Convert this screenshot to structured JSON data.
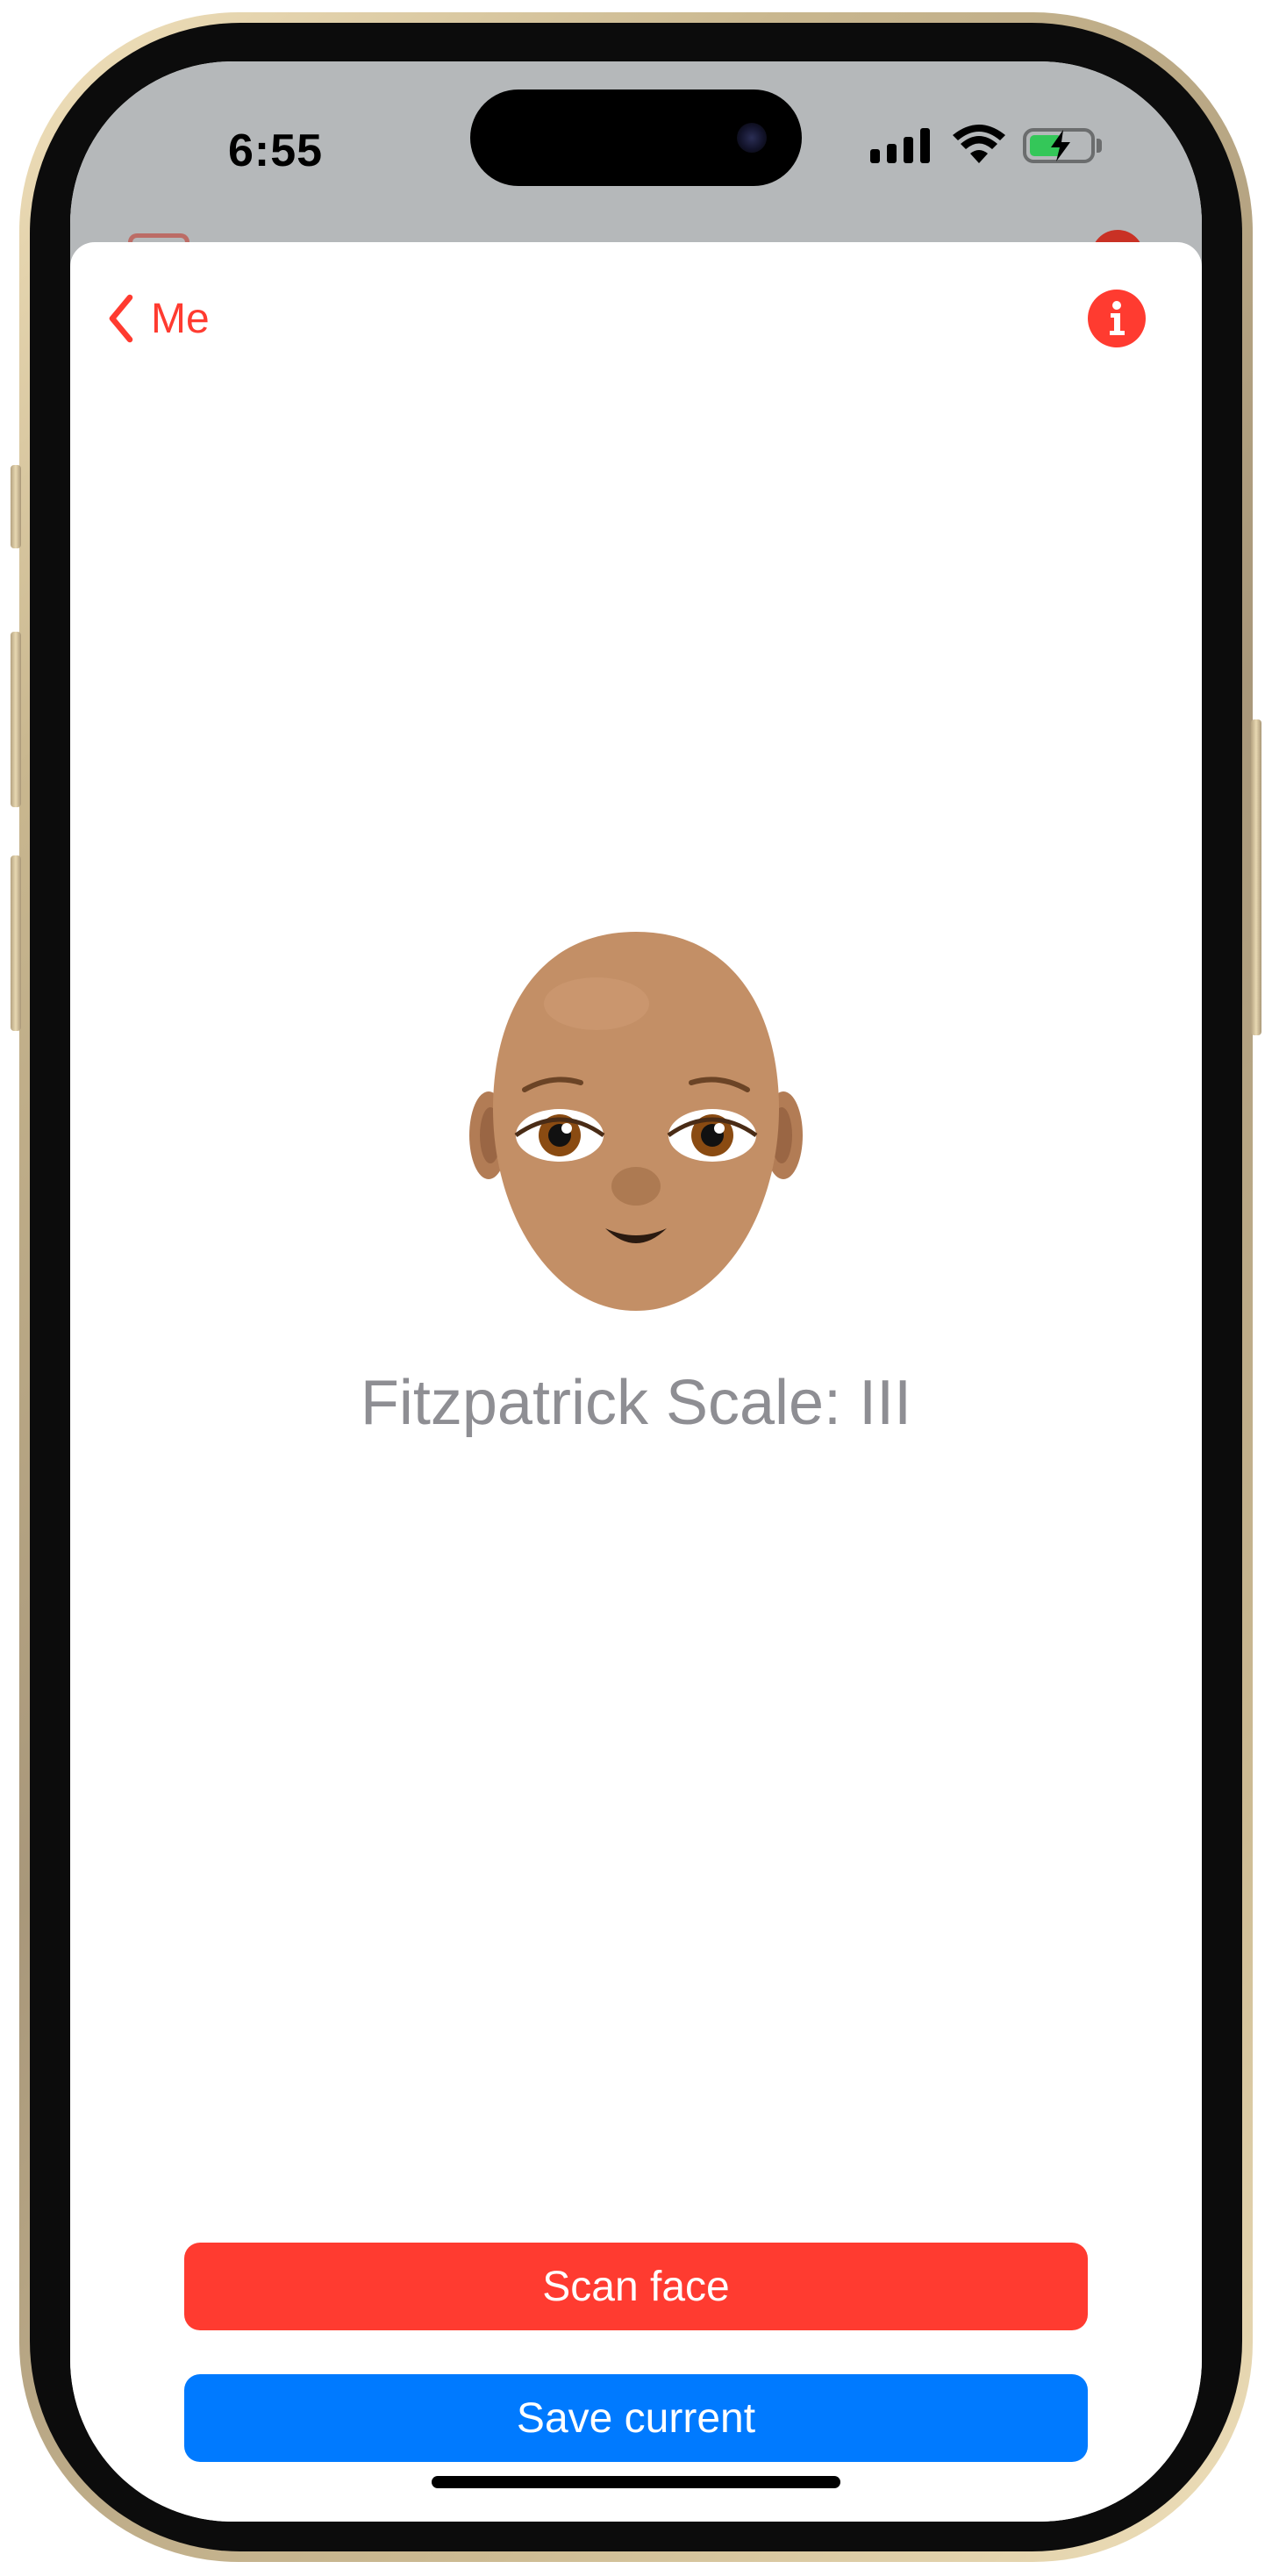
{
  "status_bar": {
    "time": "6:55",
    "icons": [
      "cellular-signal-icon",
      "wifi-icon",
      "battery-charging-icon"
    ],
    "battery_color": "#34c759"
  },
  "nav": {
    "back_label": "Me",
    "info_icon": "info-icon"
  },
  "content": {
    "face_icon": "bald-person-medium-skin-tone-emoji",
    "scale_text": "Fitzpatrick Scale: III"
  },
  "actions": {
    "scan_label": "Scan face",
    "save_label": "Save current"
  },
  "colors": {
    "accent_red": "#ff3b30",
    "accent_blue": "#007aff",
    "secondary_text": "#8e8e93"
  }
}
